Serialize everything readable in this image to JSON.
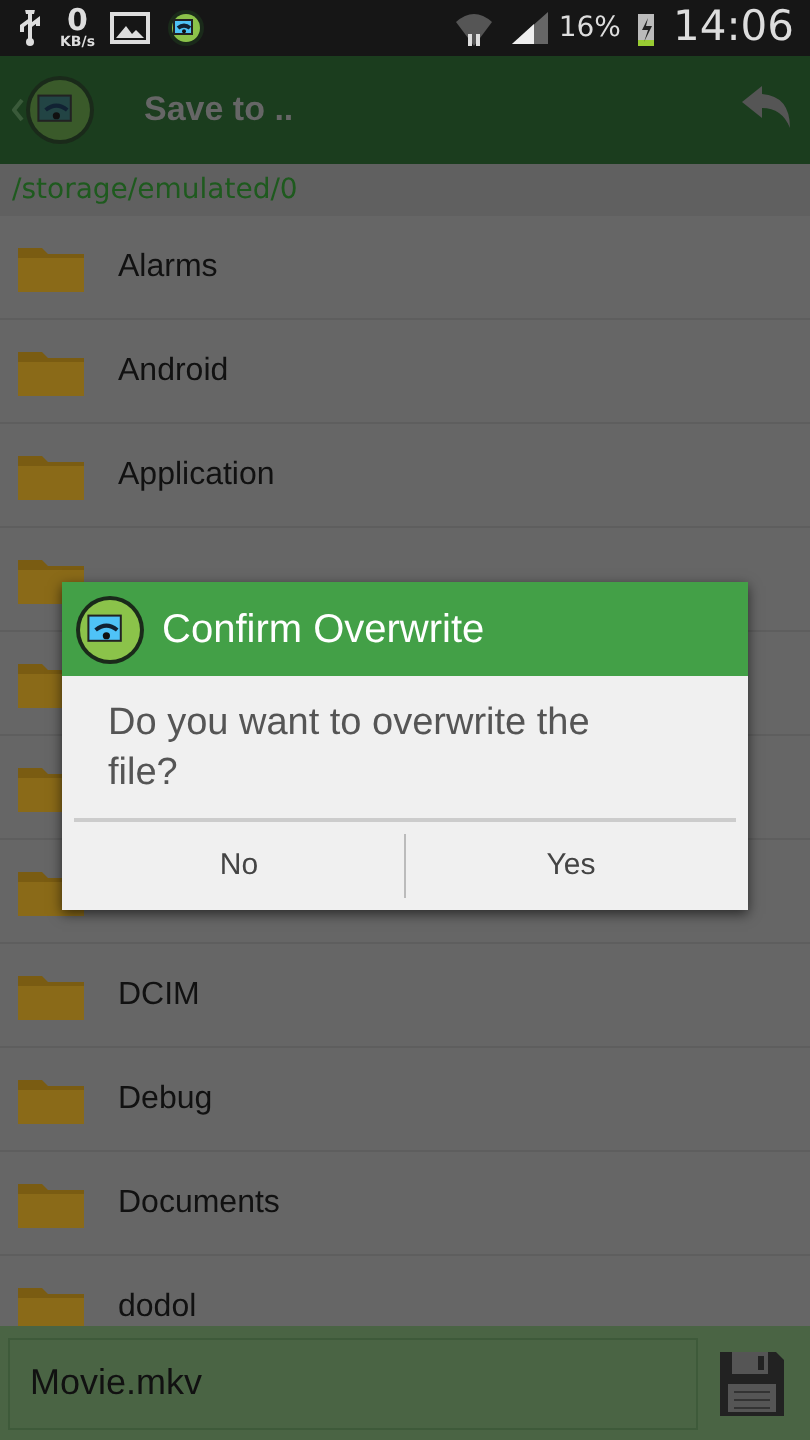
{
  "status_bar": {
    "speed": "0",
    "speed_unit": "KB/s",
    "battery": "16%",
    "time": "14:06"
  },
  "header": {
    "title": "Save to .."
  },
  "path": "/storage/emulated/0",
  "folders": [
    {
      "kind": "folder",
      "name": "Alarms"
    },
    {
      "kind": "folder",
      "name": "Android"
    },
    {
      "kind": "folder",
      "name": "Application"
    },
    {
      "kind": "folder"
    },
    {
      "kind": "folder"
    },
    {
      "kind": "folder"
    },
    {
      "kind": "folder"
    },
    {
      "kind": "folder",
      "name": "DCIM"
    },
    {
      "kind": "folder",
      "name": "Debug"
    },
    {
      "kind": "folder",
      "name": "Documents"
    },
    {
      "kind": "folder",
      "name": "dodol"
    }
  ],
  "dialog": {
    "title": "Confirm Overwrite",
    "message": "Do you want to overwrite the file?",
    "buttons": [
      "No",
      "Yes"
    ]
  },
  "filename": {
    "value": "Movie.mkv"
  }
}
